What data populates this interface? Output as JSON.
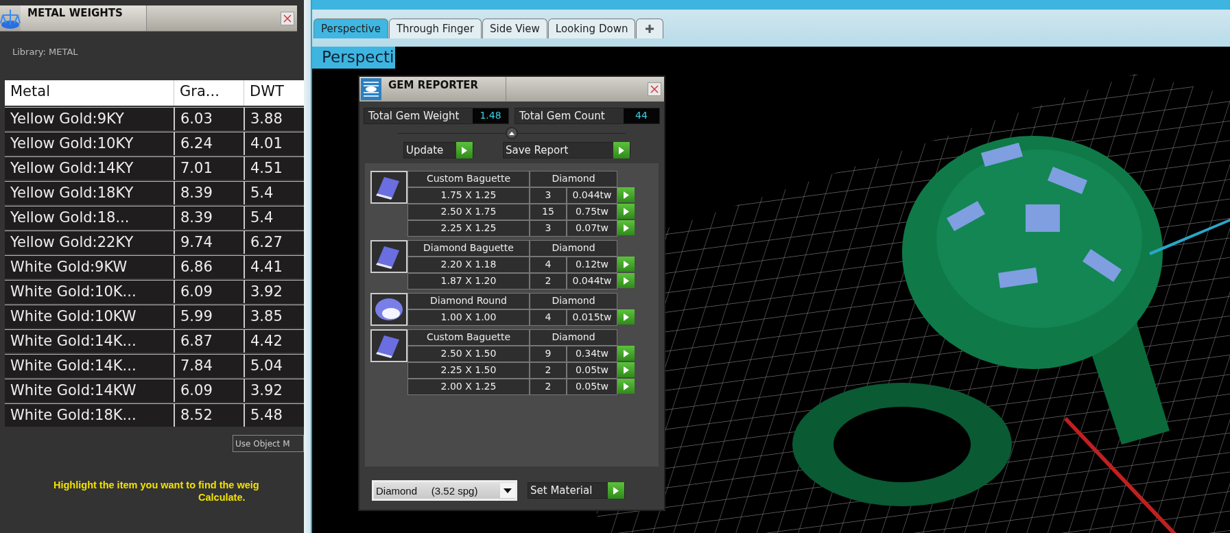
{
  "metal_weights": {
    "title": "METAL WEIGHTS",
    "library": "Library: METAL",
    "columns": [
      "Metal",
      "Gra...",
      "DWT"
    ],
    "rows": [
      [
        "Yellow Gold:9KY",
        "6.03",
        "3.88"
      ],
      [
        "Yellow Gold:10KY",
        "6.24",
        "4.01"
      ],
      [
        "Yellow Gold:14KY",
        "7.01",
        "4.51"
      ],
      [
        "Yellow Gold:18KY",
        "8.39",
        "5.4"
      ],
      [
        "Yellow Gold:18...",
        "8.39",
        "5.4"
      ],
      [
        "Yellow Gold:22KY",
        "9.74",
        "6.27"
      ],
      [
        "White Gold:9KW",
        "6.86",
        "4.41"
      ],
      [
        "White Gold:10K...",
        "6.09",
        "3.92"
      ],
      [
        "White Gold:10KW",
        "5.99",
        "3.85"
      ],
      [
        "White Gold:14K...",
        "6.87",
        "4.42"
      ],
      [
        "White Gold:14K...",
        "7.84",
        "5.04"
      ],
      [
        "White Gold:14KW",
        "6.09",
        "3.92"
      ],
      [
        "White Gold:18K...",
        "8.52",
        "5.48"
      ]
    ],
    "use_object_button": "Use Object M",
    "hint_lines": [
      "Highlight the item you want to find the weig",
      "Calculate."
    ]
  },
  "tabs": [
    {
      "label": "Perspective",
      "selected": true
    },
    {
      "label": "Through Finger",
      "selected": false
    },
    {
      "label": "Side View",
      "selected": false
    },
    {
      "label": "Looking Down",
      "selected": false
    }
  ],
  "viewport_label": "Perspecti",
  "gem_reporter": {
    "title": "GEM REPORTER",
    "total_weight_label": "Total Gem Weight",
    "total_weight": "1.48",
    "total_count_label": "Total Gem Count",
    "total_count": "44",
    "update_button": "Update",
    "save_button": "Save Report",
    "groups": [
      {
        "kind": "baguette",
        "name": "Custom Baguette",
        "material": "Diamond",
        "rows": [
          [
            "1.75 X 1.25",
            "3",
            "0.044tw"
          ],
          [
            "2.50 X 1.75",
            "15",
            "0.75tw"
          ],
          [
            "2.25 X 1.25",
            "3",
            "0.07tw"
          ]
        ]
      },
      {
        "kind": "baguette",
        "name": "Diamond Baguette",
        "material": "Diamond",
        "rows": [
          [
            "2.20 X 1.18",
            "4",
            "0.12tw"
          ],
          [
            "1.87 X 1.20",
            "2",
            "0.044tw"
          ]
        ]
      },
      {
        "kind": "round",
        "name": "Diamond Round",
        "material": "Diamond",
        "rows": [
          [
            "1.00 X 1.00",
            "4",
            "0.015tw"
          ]
        ]
      },
      {
        "kind": "baguette",
        "name": "Custom Baguette",
        "material": "Diamond",
        "rows": [
          [
            "2.50 X 1.50",
            "9",
            "0.34tw"
          ],
          [
            "2.25 X 1.50",
            "2",
            "0.05tw"
          ],
          [
            "2.00 X 1.25",
            "2",
            "0.05tw"
          ]
        ]
      }
    ],
    "material_select": "Diamond     (3.52 spg)",
    "set_material_button": "Set Material"
  }
}
